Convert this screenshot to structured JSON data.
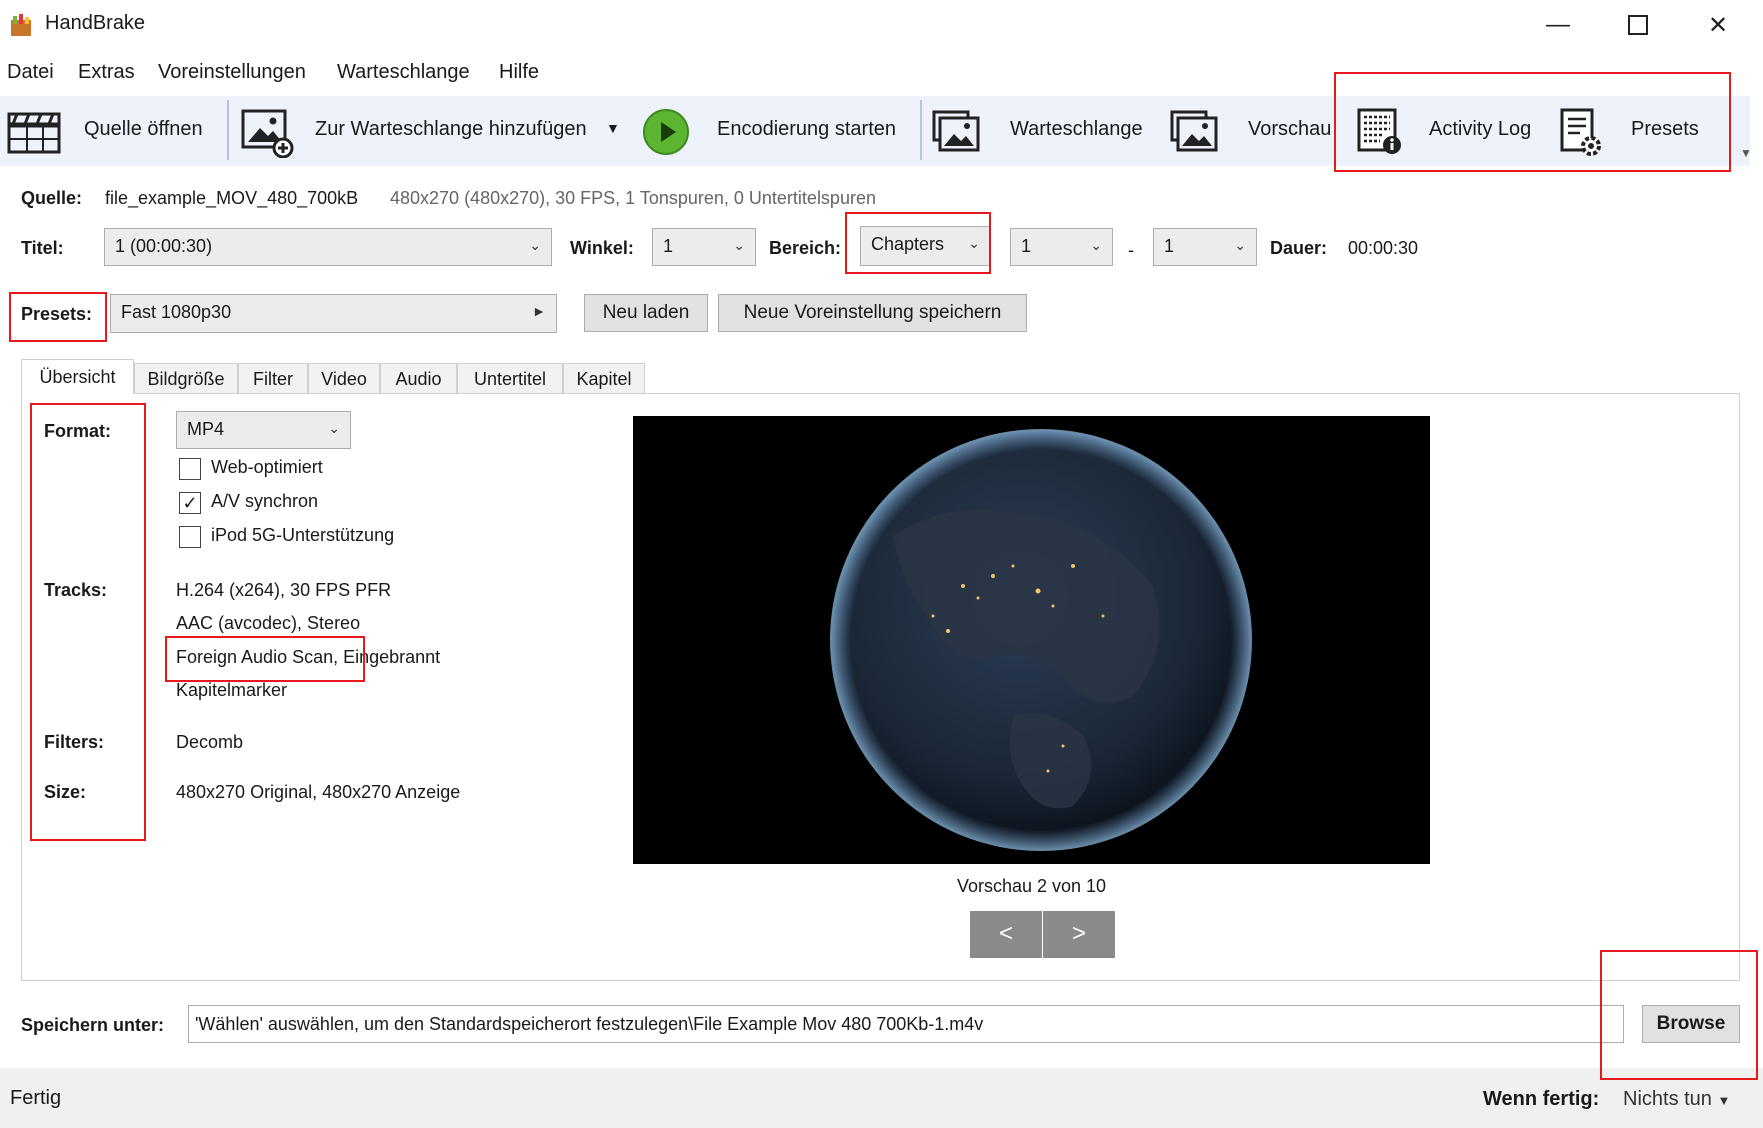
{
  "window": {
    "title": "HandBrake",
    "minimize_icon": "minimize-icon",
    "maximize_icon": "maximize-icon",
    "close_icon": "close-icon"
  },
  "menu": {
    "items": [
      "Datei",
      "Extras",
      "Voreinstellungen",
      "Warteschlange",
      "Hilfe"
    ]
  },
  "toolbar": {
    "open_source": "Quelle öffnen",
    "add_queue": "Zur Warteschlange hinzufügen",
    "start_encode": "Encodierung starten",
    "queue": "Warteschlange",
    "preview": "Vorschau",
    "activity_log": "Activity Log",
    "presets": "Presets"
  },
  "source": {
    "label": "Quelle:",
    "file": "file_example_MOV_480_700kB",
    "info": "480x270 (480x270), 30 FPS, 1 Tonspuren, 0 Untertitelspuren"
  },
  "title_row": {
    "title_label": "Titel:",
    "title_value": "1 (00:00:30)",
    "angle_label": "Winkel:",
    "angle_value": "1",
    "range_label": "Bereich:",
    "range_value": "Chapters",
    "range_start": "1",
    "range_dash": "-",
    "range_end": "1",
    "duration_label": "Dauer:",
    "duration_value": "00:00:30"
  },
  "presets_row": {
    "label": "Presets:",
    "value": "Fast 1080p30",
    "reload": "Neu laden",
    "save_new": "Neue Voreinstellung speichern"
  },
  "tabs": [
    "Übersicht",
    "Bildgröße",
    "Filter",
    "Video",
    "Audio",
    "Untertitel",
    "Kapitel"
  ],
  "summary": {
    "format_label": "Format:",
    "format_value": "MP4",
    "web_optimized": "Web-optimiert",
    "av_sync": "A/V synchron",
    "ipod": "iPod 5G-Unterstützung",
    "tracks_label": "Tracks:",
    "tracks": [
      "H.264 (x264), 30 FPS PFR",
      "AAC (avcodec), Stereo",
      "Foreign Audio Scan, Eingebrannt",
      "Kapitelmarker"
    ],
    "filters_label": "Filters:",
    "filters_value": "Decomb",
    "size_label": "Size:",
    "size_value": "480x270 Original, 480x270 Anzeige"
  },
  "preview": {
    "caption": "Vorschau 2 von 10",
    "prev": "<",
    "next": ">"
  },
  "save": {
    "label": "Speichern unter:",
    "path": "'Wählen' auswählen, um den Standardspeicherort festzulegen\\File Example Mov 480 700Kb-1.m4v",
    "browse": "Browse"
  },
  "status": {
    "text": "Fertig",
    "when_done_label": "Wenn fertig:",
    "when_done_value": "Nichts tun"
  },
  "colors": {
    "annotation_red": "#e41a1c",
    "toolbar_bg": "#eef3fb",
    "play_green": "#5cb531"
  }
}
